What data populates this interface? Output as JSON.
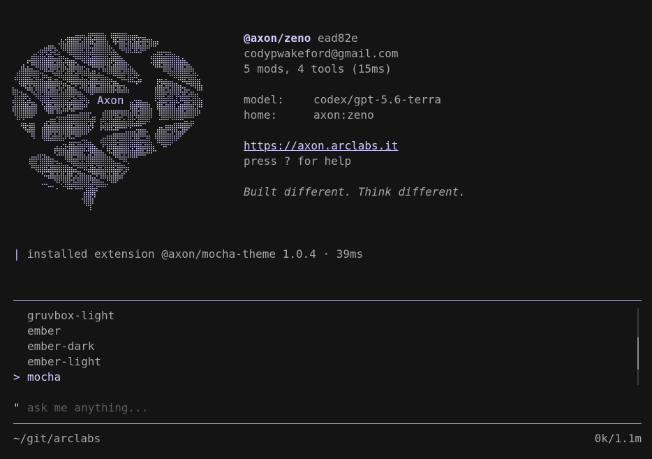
{
  "colors": {
    "background": "#141414",
    "accent": "#c9b8f4",
    "text": "#b4b4b8",
    "placeholder": "#5b5b60"
  },
  "logo": {
    "label": "Axon",
    "art_icon": "brain-ascii-art"
  },
  "profile": {
    "handle": "@axon/zeno",
    "commit": "ead82e",
    "email": "codypwakeford@gmail.com",
    "summary": "5 mods, 4 tools (15ms)",
    "model_key": "model:",
    "model_value": "codex/gpt-5.6-terra",
    "home_key": "home:",
    "home_value": "axon:zeno",
    "url": "https://axon.arclabs.it",
    "help": "press ? for help",
    "tagline": "Built different. Think different."
  },
  "notice": {
    "bar": "|",
    "text": "installed extension @axon/mocha-theme 1.0.4 · 39ms"
  },
  "theme_picker": {
    "caret": ">",
    "options": [
      {
        "label": "gruvbox-light",
        "selected": false
      },
      {
        "label": "ember",
        "selected": false
      },
      {
        "label": "ember-dark",
        "selected": false
      },
      {
        "label": "ember-light",
        "selected": false
      },
      {
        "label": "mocha",
        "selected": true
      }
    ],
    "scroll_fraction_start": 0.38,
    "scroll_fraction_end": 0.8
  },
  "prompt": {
    "quote": "\"",
    "value": "",
    "placeholder": "ask me anything..."
  },
  "status": {
    "cwd": "~/git/arclabs",
    "tokens": "0k/1.1m"
  }
}
